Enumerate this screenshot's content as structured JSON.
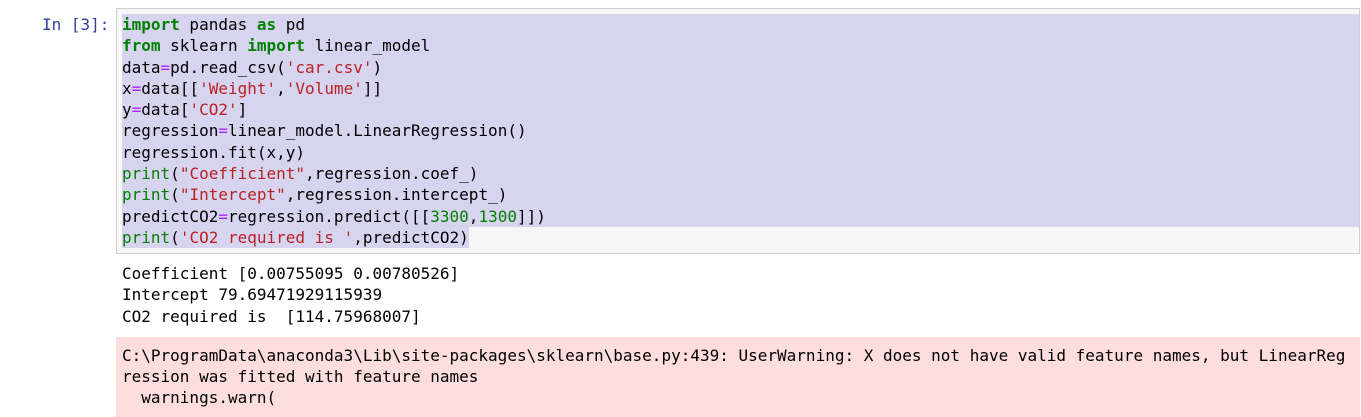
{
  "cell": {
    "prompt": "In [3]:",
    "code": {
      "l1": {
        "kw1": "import",
        "mid": " pandas ",
        "kw2": "as",
        "end": " pd"
      },
      "l2": {
        "kw1": "from",
        "mid": " sklearn ",
        "kw2": "import",
        "end": " linear_model"
      },
      "l3": {
        "a": "data",
        "op": "=",
        "b": "pd.read_csv(",
        "s": "'car.csv'",
        "c": ")"
      },
      "l4": {
        "a": "x",
        "op": "=",
        "b": "data[[",
        "s1": "'Weight'",
        "comma": ",",
        "s2": "'Volume'",
        "c": "]]"
      },
      "l5": {
        "a": "y",
        "op": "=",
        "b": "data[",
        "s": "'CO2'",
        "c": "]"
      },
      "l6": {
        "a": "regression",
        "op": "=",
        "b": "linear_model.LinearRegression()"
      },
      "l7": {
        "a": "regression.fit(x,y)"
      },
      "l8": {
        "fn": "print",
        "p": "(",
        "s": "\"Coefficient\"",
        "c": ",regression.coef_)"
      },
      "l9": {
        "fn": "print",
        "p": "(",
        "s": "\"Intercept\"",
        "c": ",regression.intercept_)"
      },
      "l10": {
        "a": "predictCO2",
        "op": "=",
        "b": "regression.predict([[",
        "n1": "3300",
        "comma": ",",
        "n2": "1300",
        "c": "]])"
      },
      "l11": {
        "fn": "print",
        "p": "(",
        "s": "'CO2 required is '",
        "c": ",predictCO2)"
      }
    }
  },
  "output": {
    "lines": [
      "Coefficient [0.00755095 0.00780526]",
      "Intercept 79.69471929115939",
      "CO2 required is  [114.75968007]"
    ]
  },
  "stderr": {
    "lines": [
      "C:\\ProgramData\\anaconda3\\Lib\\site-packages\\sklearn\\base.py:439: UserWarning: X does not have valid feature names, but LinearReg",
      "ression was fitted with feature names",
      "  warnings.warn("
    ]
  }
}
